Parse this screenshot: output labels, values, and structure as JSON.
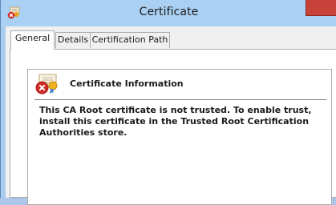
{
  "window": {
    "title": "Certificate"
  },
  "tabs": [
    {
      "label": "General"
    },
    {
      "label": "Details"
    },
    {
      "label": "Certification Path"
    }
  ],
  "general": {
    "info_title": "Certificate Information",
    "message": "This CA Root certificate is not trusted. To enable trust, install this certificate in the Trusted Root Certification Authorities store."
  },
  "icons": {
    "title": "certificate-error-icon",
    "info": "certificate-error-icon",
    "close": "close-icon"
  },
  "colors": {
    "titlebar": "#aad0f3",
    "close_button": "#c7433a",
    "error_badge": "#d12b26"
  }
}
